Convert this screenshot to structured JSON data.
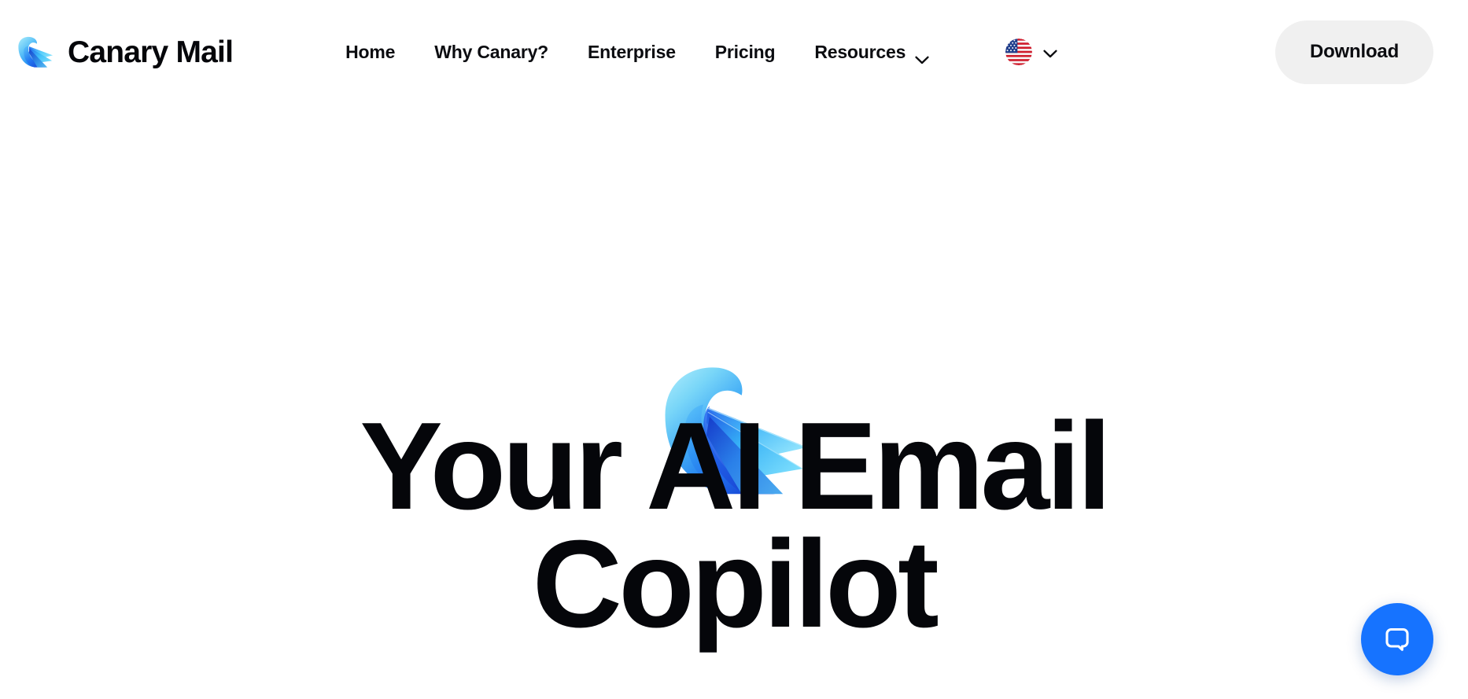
{
  "brand": {
    "name": "Canary Mail",
    "logo_icon": "canary-bird-logo-icon"
  },
  "header": {
    "nav_items": [
      {
        "label": "Home",
        "has_dropdown": false
      },
      {
        "label": "Why Canary?",
        "has_dropdown": false
      },
      {
        "label": "Enterprise",
        "has_dropdown": false
      },
      {
        "label": "Pricing",
        "has_dropdown": false
      },
      {
        "label": "Resources",
        "has_dropdown": true
      }
    ],
    "language": {
      "flag_icon": "us-flag-icon",
      "chevron_icon": "chevron-down-icon"
    },
    "download_label": "Download"
  },
  "hero": {
    "logo_icon": "canary-bird-logo-icon",
    "title": "Your AI Email\nCopilot"
  },
  "chat": {
    "icon": "chat-bubble-icon",
    "aria_label": "Open chat"
  },
  "colors": {
    "page_background": "#ffffff",
    "text_primary": "#05060a",
    "download_button_bg": "#f0f0f0",
    "chat_accent": "#1673ff",
    "logo_light_blue": "#7fd8f7",
    "logo_mid_blue": "#32a1f5",
    "logo_deep_blue": "#1648d8",
    "logo_cyan": "#49d9fb"
  }
}
